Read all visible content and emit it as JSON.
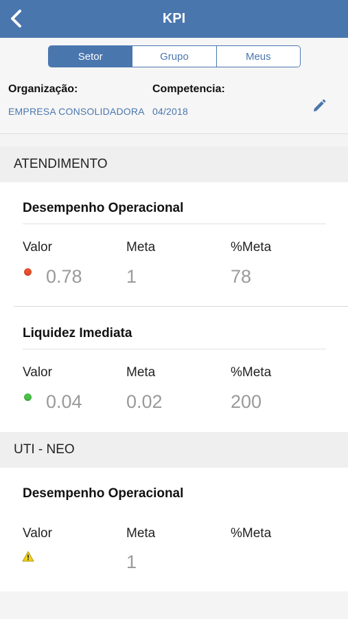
{
  "topbar": {
    "title": "KPI",
    "back_icon": "chevron-left-icon"
  },
  "tabs": [
    {
      "label": "Setor",
      "active": true
    },
    {
      "label": "Grupo",
      "active": false
    },
    {
      "label": "Meus",
      "active": false
    }
  ],
  "filters": {
    "organizacao_label": "Organização:",
    "organizacao_value": "EMPRESA CONSOLIDADORA",
    "competencia_label": "Competencia:",
    "competencia_value": "04/2018",
    "edit_icon": "pencil-icon"
  },
  "columns": {
    "valor": "Valor",
    "meta": "Meta",
    "pct_meta": "%Meta"
  },
  "colors": {
    "primary": "#4a76ae",
    "status_red": "#e8522f",
    "status_green": "#4cc24a",
    "status_warning": "#f2d21b"
  },
  "sections": [
    {
      "name": "ATENDIMENTO",
      "kpis": [
        {
          "title": "Desempenho Operacional",
          "status": "red",
          "valor": "0.78",
          "meta": "1",
          "pct_meta": "78"
        },
        {
          "title": "Liquidez Imediata",
          "status": "green",
          "valor": "0.04",
          "meta": "0.02",
          "pct_meta": "200"
        }
      ]
    },
    {
      "name": "UTI - NEO",
      "kpis": [
        {
          "title": "Desempenho Operacional",
          "status": "warning",
          "valor": "",
          "meta": "1",
          "pct_meta": ""
        }
      ]
    }
  ]
}
